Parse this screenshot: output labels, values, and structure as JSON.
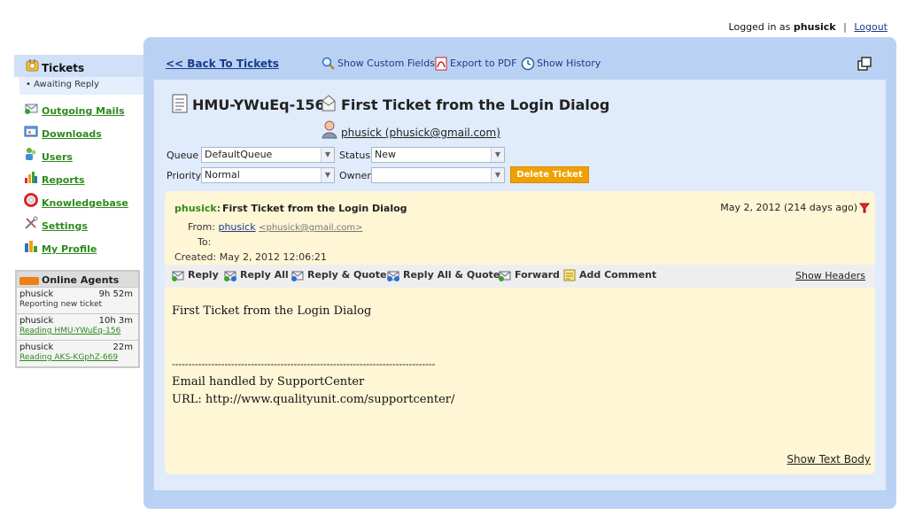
{
  "topbar": {
    "logged_in_as": "Logged in as",
    "username": "phusick",
    "separator": "|",
    "logout": "Logout"
  },
  "sidebar": {
    "active": {
      "label": "Tickets",
      "sub": "Awaiting Reply"
    },
    "items": [
      {
        "label": "Outgoing Mails",
        "icon": "outgoing-mail-icon"
      },
      {
        "label": "Downloads",
        "icon": "downloads-icon"
      },
      {
        "label": "Users",
        "icon": "users-icon"
      },
      {
        "label": "Reports",
        "icon": "reports-icon"
      },
      {
        "label": "Knowledgebase",
        "icon": "lifebuoy-icon"
      },
      {
        "label": "Settings",
        "icon": "settings-tools-icon"
      },
      {
        "label": "My Profile",
        "icon": "profile-icon"
      }
    ]
  },
  "agents": {
    "title": "Online Agents",
    "list": [
      {
        "name": "phusick",
        "time": "9h 52m",
        "activity": "Reporting new ticket",
        "link": false
      },
      {
        "name": "phusick",
        "time": "10h 3m",
        "activity": "Reading HMU-YWuEq-156",
        "link": true
      },
      {
        "name": "phusick",
        "time": "22m",
        "activity": "Reading AKS-KGphZ-669",
        "link": true
      }
    ]
  },
  "toolbar": {
    "back": "<<  Back To Tickets",
    "custom_fields": "Show Custom Fields",
    "pdf": "Export to PDF",
    "history": "Show History"
  },
  "ticket": {
    "id": "HMU-YWuEq-156",
    "subject": "First Ticket from the Login Dialog",
    "requester": "phusick (phusick@gmail.com)",
    "queue_label": "Queue",
    "queue_value": "DefaultQueue",
    "status_label": "Status",
    "status_value": "New",
    "priority_label": "Priority",
    "priority_value": "Normal",
    "owner_label": "Owner",
    "owner_value": "",
    "delete": "Delete Ticket"
  },
  "message": {
    "from_name": "phusick:",
    "subject": "First Ticket from the Login Dialog",
    "date": "May 2, 2012 (214 days ago)",
    "from_label": "From:",
    "from_user": "phusick",
    "from_email": "<phusick@gmail.com>",
    "to_label": "To:",
    "created_label": "Created:",
    "created_value": "May 2, 2012 12:06:21",
    "actions": [
      "Reply",
      "Reply All",
      "Reply & Quote",
      "Reply All & Quote",
      "Forward",
      "Add Comment"
    ],
    "show_headers": "Show Headers",
    "body_line1": "First Ticket from the Login Dialog",
    "body_sep": "--------------------------------------------------------------------------------",
    "body_line2": "Email handled by SupportCenter",
    "body_line3": "URL: http://www.qualityunit.com/supportcenter/",
    "show_text_body": "Show Text Body"
  }
}
